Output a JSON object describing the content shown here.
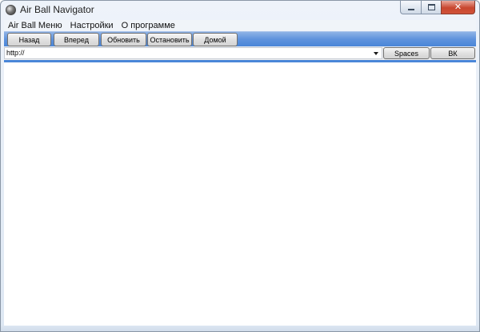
{
  "window": {
    "title": "Air Ball Navigator",
    "icon": "air-ball-icon",
    "controls": {
      "minimize_icon": "minimize-icon",
      "maximize_icon": "maximize-icon",
      "close_label": "✕"
    }
  },
  "menu": {
    "items": [
      {
        "label": "Air Ball Меню"
      },
      {
        "label": "Настройки"
      },
      {
        "label": "О программе"
      }
    ]
  },
  "navigation": {
    "back_label": "Назад",
    "forward_label": "Вперед",
    "refresh_label": "Обновить",
    "stop_label": "Остановить",
    "home_label": "Домой"
  },
  "address_bar": {
    "value": "http://",
    "dropdown_icon": "chevron-down-icon"
  },
  "side_buttons": {
    "spaces_label": "Spaces",
    "vk_label": "ВК"
  },
  "colors": {
    "toolbar_accent": "#5f93dd",
    "close_button": "#c8462f"
  }
}
